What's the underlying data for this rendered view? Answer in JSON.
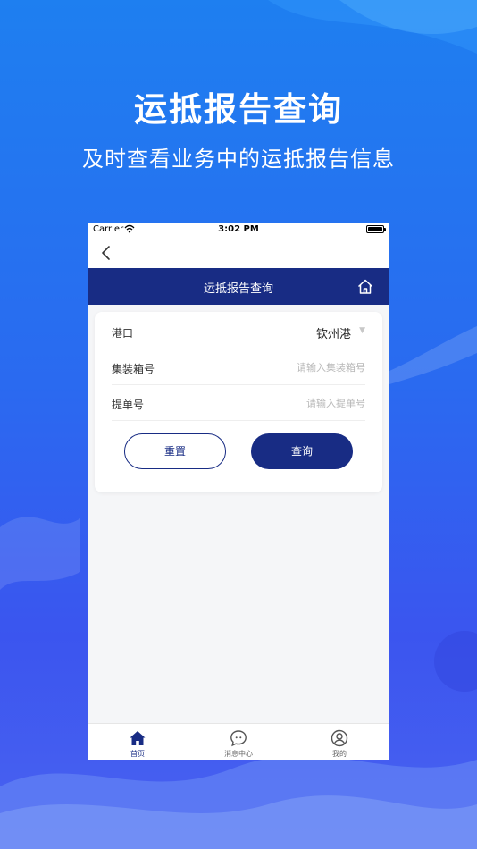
{
  "promo": {
    "title": "运抵报告查询",
    "subtitle": "及时查看业务中的运抵报告信息"
  },
  "status_bar": {
    "carrier": "Carrier",
    "time": "3:02 PM"
  },
  "header": {
    "title": "运抵报告查询"
  },
  "form": {
    "port": {
      "label": "港口",
      "value": "钦州港"
    },
    "container": {
      "label": "集装箱号",
      "placeholder": "请输入集装箱号"
    },
    "bill": {
      "label": "提单号",
      "placeholder": "请输入提单号"
    },
    "reset_label": "重置",
    "query_label": "查询"
  },
  "tabs": [
    {
      "label": "首页",
      "icon": "home-icon",
      "active": true
    },
    {
      "label": "消息中心",
      "icon": "chat-bubble-icon",
      "active": false
    },
    {
      "label": "我的",
      "icon": "user-icon",
      "active": false
    }
  ],
  "colors": {
    "primary": "#182c84",
    "background_top": "#1e7ff0",
    "background_bottom": "#4a63f0"
  }
}
